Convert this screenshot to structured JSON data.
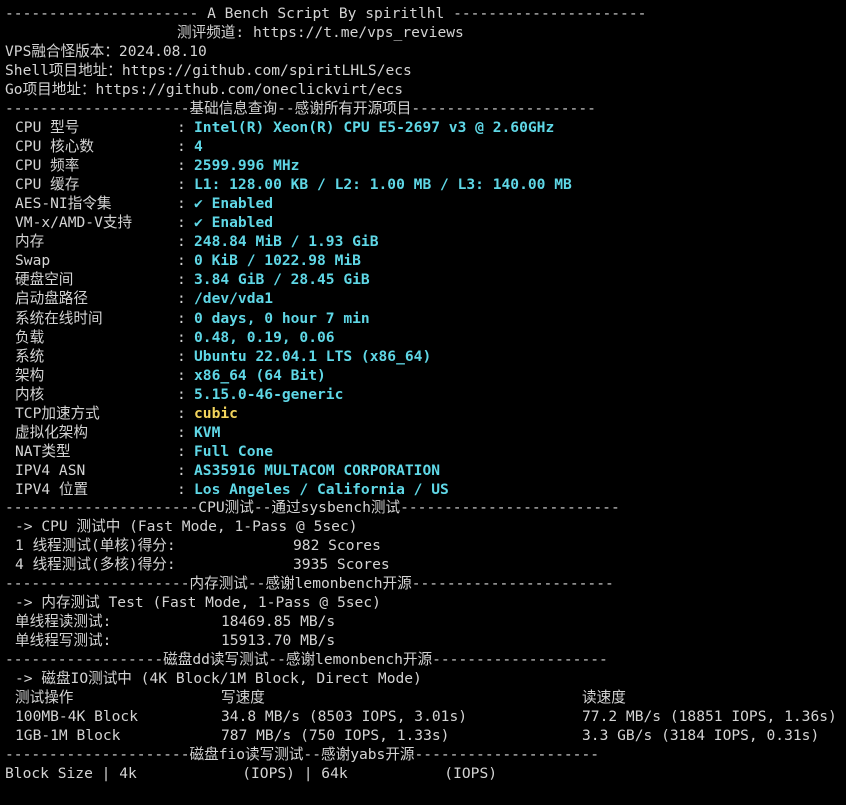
{
  "header": {
    "title_line": "---------------------- A Bench Script By spiritlhl ----------------------",
    "channel_line": "测评频道: https://t.me/vps_reviews",
    "version_line": "VPS融合怪版本：2024.08.10",
    "shell_line": "Shell项目地址：https://github.com/spiritLHLS/ecs",
    "go_line": "Go项目地址：https://github.com/oneclickvirt/ecs"
  },
  "colors": {
    "background": "#000000",
    "text": "#d4d4d4",
    "value_cyan": "#5fd7e6",
    "value_yellow": "#f2d45c"
  },
  "basic_info": {
    "separator": "---------------------基础信息查询--感谢所有开源项目---------------------",
    "rows": [
      {
        "label": "CPU 型号",
        "value": "Intel(R) Xeon(R) CPU E5-2697 v3 @ 2.60GHz"
      },
      {
        "label": "CPU 核心数",
        "value": "4"
      },
      {
        "label": "CPU 频率",
        "value": "2599.996 MHz"
      },
      {
        "label": "CPU 缓存",
        "value": "L1: 128.00 KB / L2: 1.00 MB / L3: 140.00 MB"
      },
      {
        "label": "AES-NI指令集",
        "value": "✔ Enabled"
      },
      {
        "label": "VM-x/AMD-V支持",
        "value": "✔ Enabled"
      },
      {
        "label": "内存",
        "value": "248.84 MiB / 1.93 GiB"
      },
      {
        "label": "Swap",
        "value": "0 KiB / 1022.98 MiB"
      },
      {
        "label": "硬盘空间",
        "value": "3.84 GiB / 28.45 GiB"
      },
      {
        "label": "启动盘路径",
        "value": "/dev/vda1"
      },
      {
        "label": "系统在线时间",
        "value": "0 days, 0 hour 7 min"
      },
      {
        "label": "负载",
        "value": "0.48, 0.19, 0.06"
      },
      {
        "label": "系统",
        "value": "Ubuntu 22.04.1 LTS (x86_64)"
      },
      {
        "label": "架构",
        "value": "x86_64 (64 Bit)"
      },
      {
        "label": "内核",
        "value": "5.15.0-46-generic"
      },
      {
        "label": "TCP加速方式",
        "value": "cubic",
        "highlight": "yellow"
      },
      {
        "label": "虚拟化架构",
        "value": "KVM"
      },
      {
        "label": "NAT类型",
        "value": "Full Cone"
      },
      {
        "label": "IPV4 ASN",
        "value": "AS35916 MULTACOM CORPORATION"
      },
      {
        "label": "IPV4 位置",
        "value": "Los Angeles / California / US"
      }
    ],
    "colon": ":"
  },
  "cpu_test": {
    "separator": "----------------------CPU测试--通过sysbench测试-------------------------",
    "mode_line": "-> CPU 测试中 (Fast Mode, 1-Pass @ 5sec)",
    "rows": [
      {
        "label": "1 线程测试(单核)得分:",
        "value": "982 Scores"
      },
      {
        "label": "4 线程测试(多核)得分:",
        "value": "3935 Scores"
      }
    ]
  },
  "memory_test": {
    "separator": "---------------------内存测试--感谢lemonbench开源-----------------------",
    "mode_line": "-> 内存测试 Test (Fast Mode, 1-Pass @ 5sec)",
    "rows": [
      {
        "label": "单线程读测试:",
        "value": "18469.85 MB/s"
      },
      {
        "label": "单线程写测试:",
        "value": "15913.70 MB/s"
      }
    ]
  },
  "disk_dd_test": {
    "separator": "------------------磁盘dd读写测试--感谢lemonbench开源--------------------",
    "mode_line": "-> 磁盘IO测试中 (4K Block/1M Block, Direct Mode)",
    "headers": {
      "op": "测试操作",
      "write": "写速度",
      "read": "读速度"
    },
    "rows": [
      {
        "op": "100MB-4K Block",
        "write": "34.8 MB/s (8503 IOPS, 3.01s)",
        "read": "77.2 MB/s (18851 IOPS, 1.36s)"
      },
      {
        "op": "1GB-1M Block",
        "write": "787 MB/s (750 IOPS, 1.33s)",
        "read": "3.3 GB/s (3184 IOPS, 0.31s)"
      }
    ]
  },
  "disk_fio_test": {
    "separator": "---------------------磁盘fio读写测试--感谢yabs开源---------------------",
    "header_line": "Block Size | 4k            (IOPS) | 64k           (IOPS)"
  }
}
